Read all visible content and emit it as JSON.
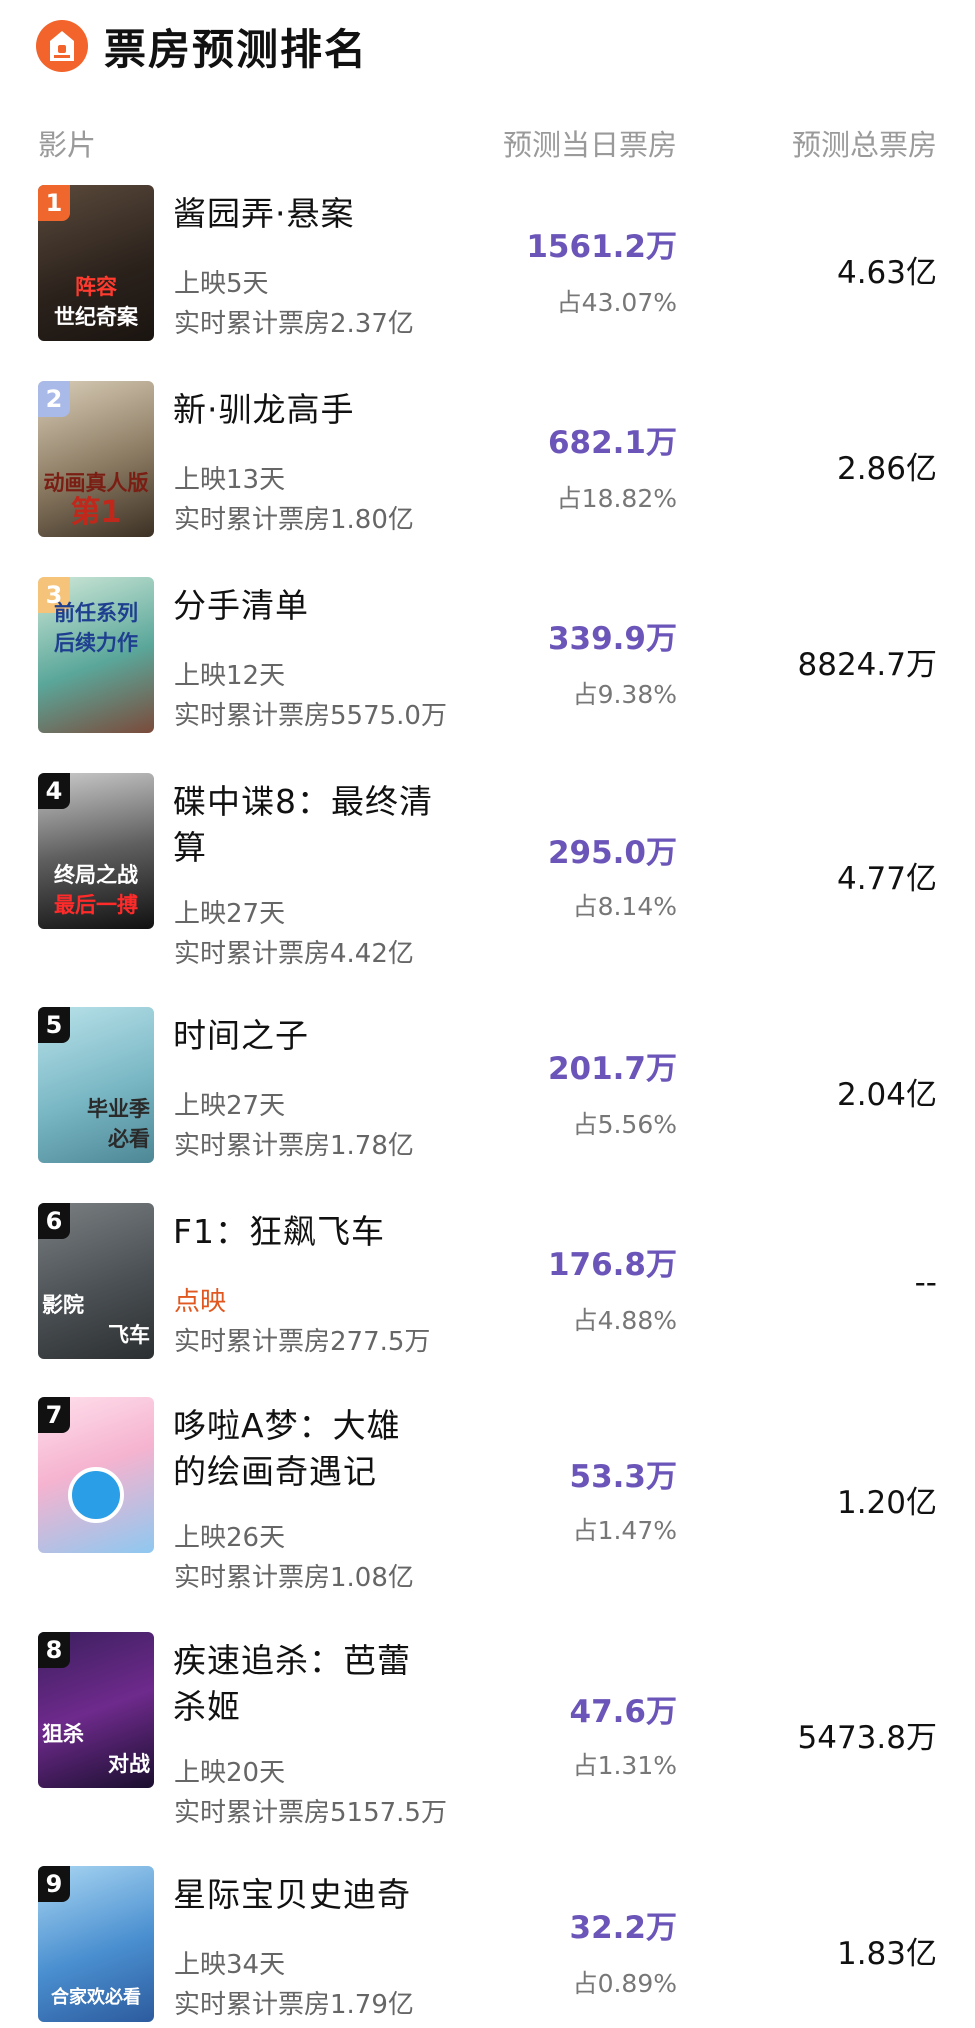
{
  "header": {
    "title": "票房预测排名"
  },
  "columns": {
    "film": "影片",
    "day_box": "预测当日票房",
    "total_box": "预测总票房"
  },
  "movies": [
    {
      "rank": "1",
      "name": "酱园弄·悬案",
      "days": "上映5天",
      "cumulative": "实时累计票房2.37亿",
      "day_box": "1561.2万",
      "share": "占43.07%",
      "total": "4.63亿",
      "poster_top": "",
      "poster_bottom": "世纪奇案"
    },
    {
      "rank": "2",
      "name": "新·驯龙高手",
      "days": "上映13天",
      "cumulative": "实时累计票房1.80亿",
      "day_box": "682.1万",
      "share": "占18.82%",
      "total": "2.86亿",
      "poster_top": "动画真人版",
      "poster_bottom": "第1"
    },
    {
      "rank": "3",
      "name": "分手清单",
      "days": "上映12天",
      "cumulative": "实时累计票房5575.0万",
      "day_box": "339.9万",
      "share": "占9.38%",
      "total": "8824.7万",
      "poster_top": "前任系列",
      "poster_bottom": "后续力作"
    },
    {
      "rank": "4",
      "name": "碟中谍8：最终清算",
      "days": "上映27天",
      "cumulative": "实时累计票房4.42亿",
      "day_box": "295.0万",
      "share": "占8.14%",
      "total": "4.77亿",
      "poster_top": "终局之战",
      "poster_bottom": "最后一搏"
    },
    {
      "rank": "5",
      "name": "时间之子",
      "days": "上映27天",
      "cumulative": "实时累计票房1.78亿",
      "day_box": "201.7万",
      "share": "占5.56%",
      "total": "2.04亿",
      "poster_top": "毕业季",
      "poster_bottom": "必看"
    },
    {
      "rank": "6",
      "name": "F1：狂飙飞车",
      "days": "点映",
      "cumulative": "实时累计票房277.5万",
      "day_box": "176.8万",
      "share": "占4.88%",
      "total": "--",
      "poster_top": "影院",
      "poster_bottom": "飞车"
    },
    {
      "rank": "7",
      "name": "哆啦A梦：大雄的绘画奇遇记",
      "days": "上映26天",
      "cumulative": "实时累计票房1.08亿",
      "day_box": "53.3万",
      "share": "占1.47%",
      "total": "1.20亿",
      "poster_top": "",
      "poster_bottom": ""
    },
    {
      "rank": "8",
      "name": "疾速追杀：芭蕾杀姬",
      "days": "上映20天",
      "cumulative": "实时累计票房5157.5万",
      "day_box": "47.6万",
      "share": "占1.31%",
      "total": "5473.8万",
      "poster_top": "狙杀",
      "poster_bottom": "对战"
    },
    {
      "rank": "9",
      "name": "星际宝贝史迪奇",
      "days": "上映34天",
      "cumulative": "实时累计票房1.79亿",
      "day_box": "32.2万",
      "share": "占0.89%",
      "total": "1.83亿",
      "poster_top": "",
      "poster_bottom": "合家欢必看"
    }
  ]
}
